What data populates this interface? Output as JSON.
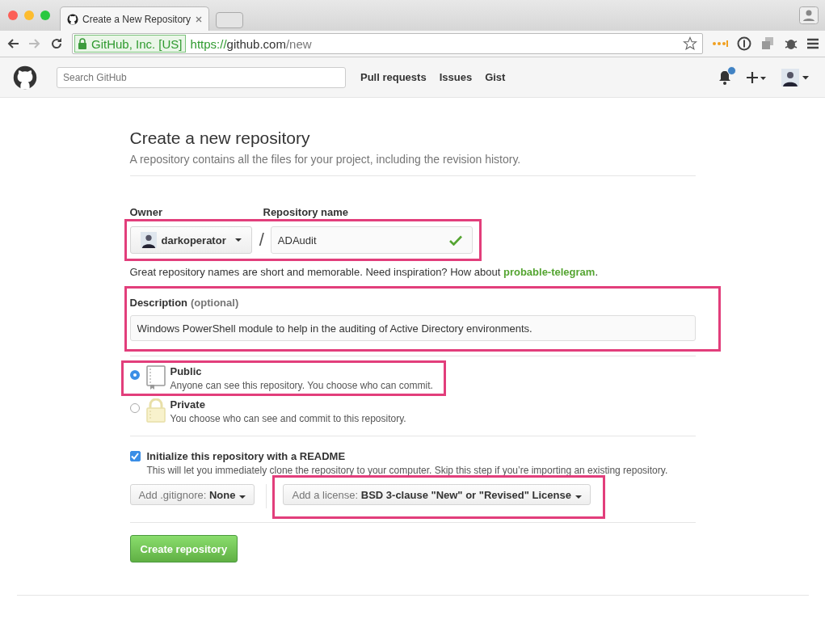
{
  "browser": {
    "tab_title": "Create a New Repository",
    "identity": "GitHub, Inc. [US]",
    "url_scheme": "https://",
    "url_host": "github.com",
    "url_path": "/new"
  },
  "header": {
    "search_placeholder": "Search GitHub",
    "nav": [
      "Pull requests",
      "Issues",
      "Gist"
    ],
    "has_notification": true
  },
  "page": {
    "title": "Create a new repository",
    "subtitle": "A repository contains all the files for your project, including the revision history.",
    "owner_label": "Owner",
    "owner": "darkoperator",
    "separator": "/",
    "name_label": "Repository name",
    "name_value": "ADAudit",
    "name_valid": true,
    "hint": "Great repository names are short and memorable. Need inspiration? How about",
    "suggestion": "probable-telegram",
    "hint_end": ".",
    "description_label": "Description",
    "description_note": "(optional)",
    "description_value": "Windows PowerShell module to help in the auditing of Active Directory environments.",
    "visibility": [
      {
        "kind": "public",
        "title": "Public",
        "desc": "Anyone can see this repository. You choose who can commit.",
        "selected": true
      },
      {
        "kind": "private",
        "title": "Private",
        "desc": "You choose who can see and commit to this repository.",
        "selected": false
      }
    ],
    "readme": {
      "label": "Initialize this repository with a README",
      "desc": "This will let you immediately clone the repository to your computer. Skip this step if you’re importing an existing repository.",
      "checked": true
    },
    "gitignore": {
      "label": "Add .gitignore:",
      "value": "None"
    },
    "license": {
      "label": "Add a license:",
      "value": "BSD 3-clause \"New\" or \"Revised\" License"
    },
    "submit": "Create repository"
  }
}
